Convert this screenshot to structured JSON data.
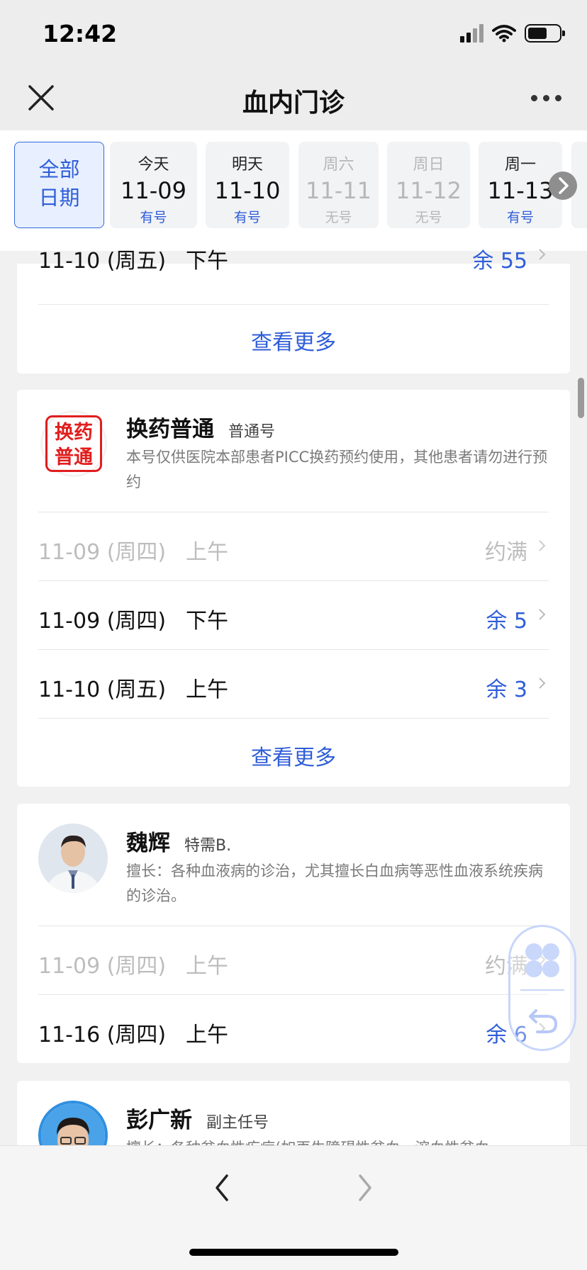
{
  "status": {
    "time": "12:42"
  },
  "nav": {
    "title": "血内门诊"
  },
  "dates": {
    "all": [
      "全部",
      "日期"
    ],
    "items": [
      {
        "week": "今天",
        "date": "11-09",
        "avail": "有号",
        "enabled": true
      },
      {
        "week": "明天",
        "date": "11-10",
        "avail": "有号",
        "enabled": true
      },
      {
        "week": "周六",
        "date": "11-11",
        "avail": "无号",
        "enabled": false
      },
      {
        "week": "周日",
        "date": "11-12",
        "avail": "无号",
        "enabled": false
      },
      {
        "week": "周一",
        "date": "11-13",
        "avail": "有号",
        "enabled": true
      }
    ]
  },
  "card0": {
    "rows": [
      {
        "date": "11-10 (周五)",
        "period": "下午",
        "status": "余 55",
        "full": false
      }
    ],
    "more": "查看更多"
  },
  "card1": {
    "stamp": [
      "换药",
      "普通"
    ],
    "name": "换药普通",
    "type": "普通号",
    "desc": "本号仅供医院本部患者PICC换药预约使用，其他患者请勿进行预约",
    "rows": [
      {
        "date": "11-09 (周四)",
        "period": "上午",
        "status": "约满",
        "full": true
      },
      {
        "date": "11-09 (周四)",
        "period": "下午",
        "status": "余 5",
        "full": false
      },
      {
        "date": "11-10 (周五)",
        "period": "上午",
        "status": "余 3",
        "full": false
      }
    ],
    "more": "查看更多"
  },
  "card2": {
    "name": "魏辉",
    "type": "特需B.",
    "desc": "擅长：各种血液病的诊治，尤其擅长白血病等恶性血液系统疾病的诊治。",
    "rows": [
      {
        "date": "11-09 (周四)",
        "period": "上午",
        "status": "约满",
        "full": true
      },
      {
        "date": "11-16 (周四)",
        "period": "上午",
        "status": "余 6",
        "full": false
      }
    ]
  },
  "card3": {
    "name": "彭广新",
    "type": "副主任号",
    "desc": "擅长：各种贫血性疾病(如再生障碍性贫血、溶血性贫血"
  },
  "colors": {
    "accent": "#2f5ed8",
    "disabled": "#bdbdbd",
    "stamp": "#e11d1d"
  }
}
